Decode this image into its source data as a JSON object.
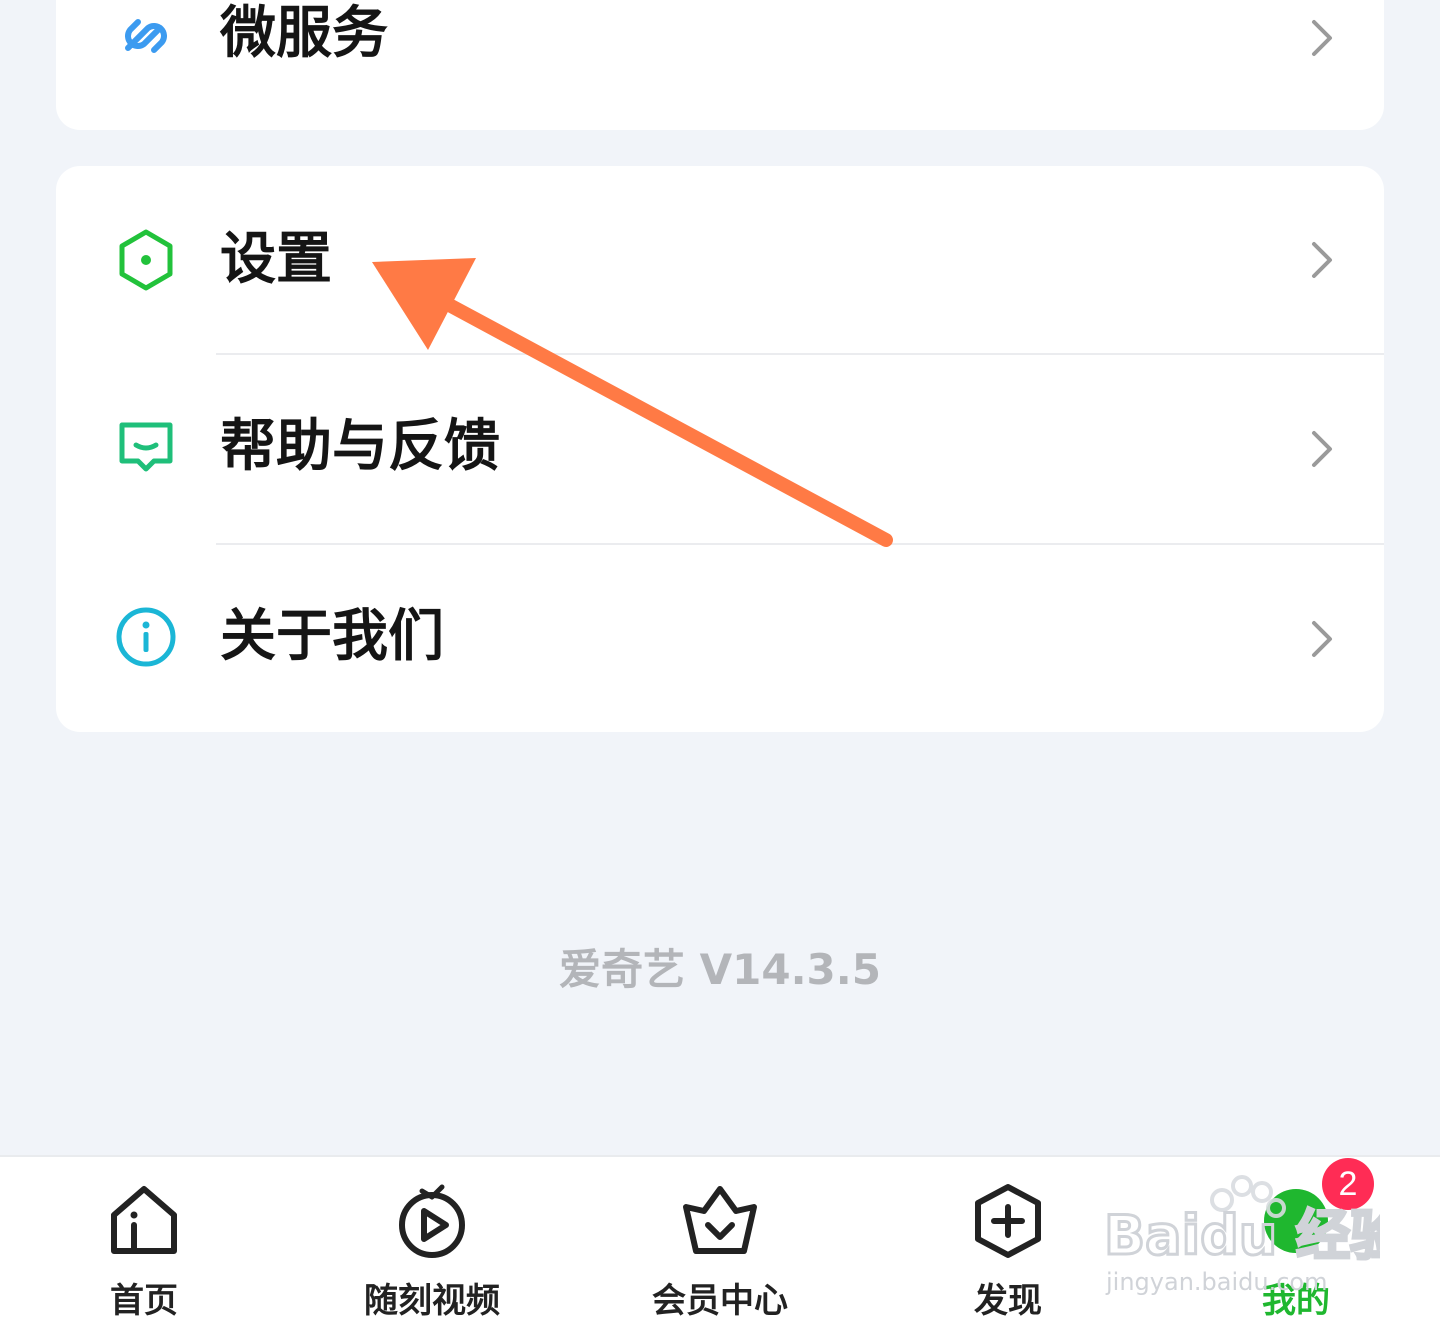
{
  "menu_top": {
    "items": [
      {
        "label": "微服务",
        "icon": "link-icon"
      }
    ]
  },
  "menu_main": {
    "items": [
      {
        "label": "设置",
        "icon": "hexagon-settings-icon"
      },
      {
        "label": "帮助与反馈",
        "icon": "feedback-chat-icon"
      },
      {
        "label": "关于我们",
        "icon": "info-icon"
      }
    ]
  },
  "version_text": "爱奇艺 V14.3.5",
  "tabbar": {
    "tabs": [
      {
        "label": "首页",
        "icon": "home-icon"
      },
      {
        "label": "随刻视频",
        "icon": "video-play-icon"
      },
      {
        "label": "会员中心",
        "icon": "vip-crown-icon"
      },
      {
        "label": "发现",
        "icon": "discover-plus-icon"
      },
      {
        "label": "我的",
        "icon": "profile-icon",
        "active": true,
        "badge": "2"
      }
    ]
  },
  "watermark": {
    "brand": "Baidu 经验",
    "url": "jingyan.baidu.com"
  },
  "colors": {
    "background": "#f1f4f9",
    "accent_green": "#1fb72f",
    "badge_red": "#ff2c55",
    "annotation_arrow": "#ff7a45"
  }
}
